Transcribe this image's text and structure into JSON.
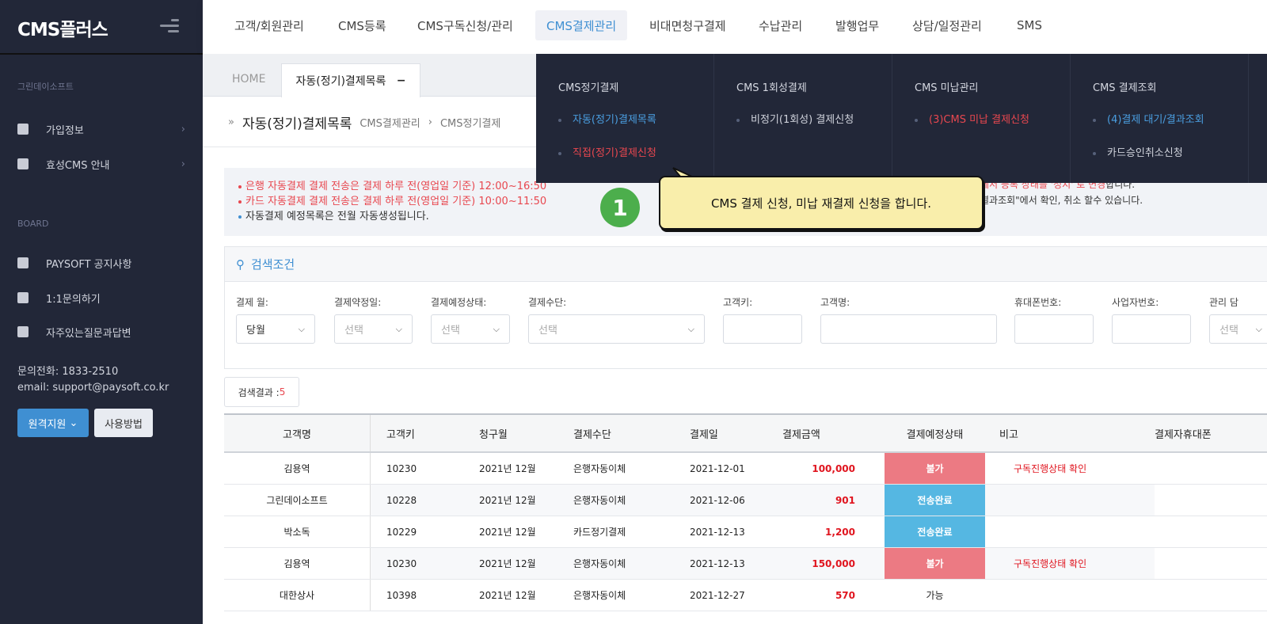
{
  "sidebar": {
    "logo": "CMS플러스",
    "company": "그린데이소프트",
    "items": [
      {
        "label": "가입정보",
        "icon": "id-card-icon"
      },
      {
        "label": "효성CMS 안내",
        "icon": "wallet-icon"
      }
    ],
    "board_label": "BOARD",
    "board_items": [
      {
        "label": "PAYSOFT 공지사항",
        "icon": "mail-icon"
      },
      {
        "label": "1:1문의하기",
        "icon": "edit-icon"
      },
      {
        "label": "자주있는질문과답변",
        "icon": "document-icon"
      }
    ],
    "phone": "문의전화: 1833-2510",
    "email": "email: support@paysoft.co.kr",
    "remote_btn": "원격지원",
    "howto_btn": "사용방법"
  },
  "nav": {
    "items": [
      "고객/회원관리",
      "CMS등록",
      "CMS구독신청/관리",
      "CMS결제관리",
      "비대면청구결제",
      "수납관리",
      "발행업무",
      "상담/일정관리",
      "SMS"
    ],
    "active": "CMS결제관리"
  },
  "tabs": {
    "home": "HOME",
    "current": "자동(정기)결제목록",
    "close": "−"
  },
  "page": {
    "title": "자동(정기)결제목록",
    "breadcrumb": [
      "CMS결제관리",
      "CMS정기결제"
    ]
  },
  "notice": {
    "lines": [
      "은행 자동결제 결제 전송은 결제 하루 전(영업일 기준) 12:00~16:50",
      "카드 자동결제 결제 전송은 결제 하루 전(영업일 기준) 10:00~11:50",
      "자동결제 예정목록은 전월 자동생성됩니다."
    ],
    "right_lines": [
      "에서 등록 상태를 '정지' 로 변경",
      "합니다.",
      "결과조회\"에서 확인, 취소 할수 있습니다."
    ]
  },
  "search": {
    "title": "검색조건",
    "fields": [
      {
        "label": "결제 월:",
        "value": "당월"
      },
      {
        "label": "결제약정일:",
        "value": "선택"
      },
      {
        "label": "결제예정상태:",
        "value": "선택"
      },
      {
        "label": "결제수단:",
        "value": "선택"
      },
      {
        "label": "고객키:",
        "value": ""
      },
      {
        "label": "고객명:",
        "value": ""
      },
      {
        "label": "휴대폰번호:",
        "value": ""
      },
      {
        "label": "사업자번호:",
        "value": ""
      },
      {
        "label": "관리 담",
        "value": "선택"
      }
    ]
  },
  "result": {
    "label": "검색결과 : ",
    "count": "5"
  },
  "table": {
    "headers": [
      "고객명",
      "고객키",
      "청구월",
      "결제수단",
      "결제일",
      "결제금액",
      "결제예정상태",
      "비고",
      "결제자휴대폰"
    ],
    "rows": [
      {
        "name": "김용역",
        "key": "10230",
        "month": "2021년 12월",
        "method": "은행자동이체",
        "date": "2021-12-01",
        "amount": "100,000",
        "status": "불가",
        "note": "구독진행상태 확인"
      },
      {
        "name": "그린데이소프트",
        "key": "10228",
        "month": "2021년 12월",
        "method": "은행자동이체",
        "date": "2021-12-06",
        "amount": "901",
        "status": "전송완료",
        "note": ""
      },
      {
        "name": "박소독",
        "key": "10229",
        "month": "2021년 12월",
        "method": "카드정기결제",
        "date": "2021-12-13",
        "amount": "1,200",
        "status": "전송완료",
        "note": ""
      },
      {
        "name": "김용역",
        "key": "10230",
        "month": "2021년 12월",
        "method": "은행자동이체",
        "date": "2021-12-13",
        "amount": "150,000",
        "status": "불가",
        "note": "구독진행상태 확인"
      },
      {
        "name": "대한상사",
        "key": "10398",
        "month": "2021년 12월",
        "method": "은행자동이체",
        "date": "2021-12-27",
        "amount": "570",
        "status": "가능",
        "note": ""
      }
    ]
  },
  "status_colors": {
    "불가": "#ec7a83",
    "전송완료": "#55b7e2",
    "가능": "transparent"
  },
  "mega_menu": {
    "columns": [
      {
        "title": "CMS정기결제",
        "items": [
          {
            "label": "자동(정기)결제목록",
            "color": "#4a9ee0"
          },
          {
            "label": "직접(정기)결제신청",
            "color": "#e8474f"
          }
        ]
      },
      {
        "title": "CMS 1회성결제",
        "items": [
          {
            "label": "비정기(1회성) 결제신청",
            "color": "#cfd2db"
          }
        ]
      },
      {
        "title": "CMS 미납관리",
        "items": [
          {
            "label": "(3)CMS 미납 결제신청",
            "color": "#e8474f"
          }
        ]
      },
      {
        "title": "CMS 결제조회",
        "items": [
          {
            "label": "(4)결제 대기/결과조회",
            "color": "#4a9ee0"
          },
          {
            "label": "카드승인취소신청",
            "color": "#cfd2db"
          }
        ]
      }
    ]
  },
  "callout": {
    "number": "1",
    "text": "CMS 결제 신청, 미납 재결제 신청을 합니다."
  }
}
